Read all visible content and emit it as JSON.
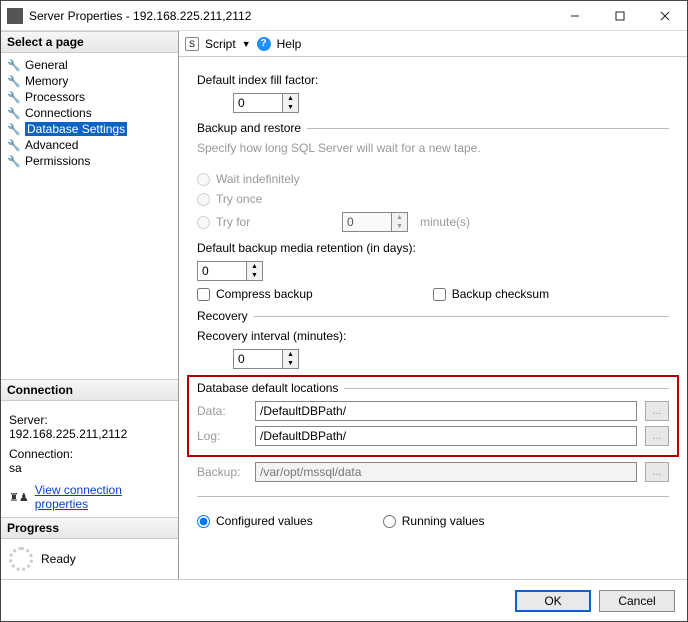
{
  "title": "Server Properties - 192.168.225.211,2112",
  "leftPanel": {
    "selectPageHeader": "Select a page",
    "pages": {
      "general": "General",
      "memory": "Memory",
      "processors": "Processors",
      "connections": "Connections",
      "dbsettings": "Database Settings",
      "advanced": "Advanced",
      "permissions": "Permissions"
    },
    "connectionHeader": "Connection",
    "serverLabel": "Server:",
    "serverValue": "192.168.225.211,2112",
    "connLabel": "Connection:",
    "connValue": "sa",
    "viewConnLink": "View connection properties",
    "progressHeader": "Progress",
    "progressStatus": "Ready"
  },
  "toolbar": {
    "script": "Script",
    "help": "Help"
  },
  "content": {
    "fillFactorLabel": "Default index fill factor:",
    "fillFactorValue": "0",
    "backupRestoreHeader": "Backup and restore",
    "backupHint": "Specify how long SQL Server will wait for a new tape.",
    "waitIndef": "Wait indefinitely",
    "tryOnce": "Try once",
    "tryFor": "Try for",
    "tryForValue": "0",
    "minutes": "minute(s)",
    "retentionLabel": "Default backup media retention (in days):",
    "retentionValue": "0",
    "compressBackup": "Compress backup",
    "backupChecksum": "Backup checksum",
    "recoveryHeader": "Recovery",
    "recoveryIntervalLabel": "Recovery interval (minutes):",
    "recoveryIntervalValue": "0",
    "dbLocationsHeader": "Database default locations",
    "dataLabel": "Data:",
    "dataValue": "/DefaultDBPath/",
    "logLabel": "Log:",
    "logValue": "/DefaultDBPath/",
    "backupLabel": "Backup:",
    "backupValue": "/var/opt/mssql/data",
    "configuredValues": "Configured values",
    "runningValues": "Running values"
  },
  "footer": {
    "ok": "OK",
    "cancel": "Cancel"
  }
}
